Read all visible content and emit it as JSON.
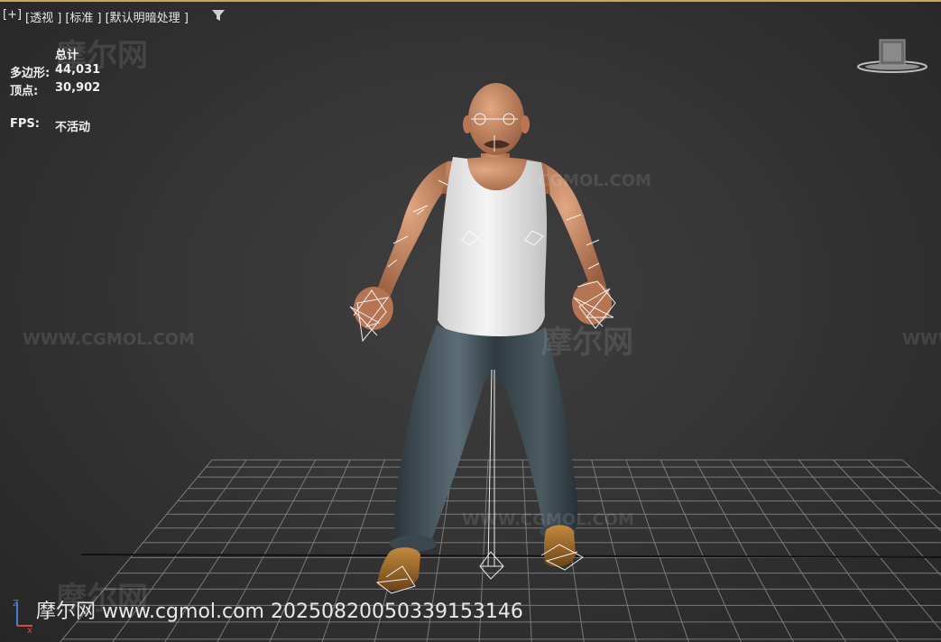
{
  "viewport": {
    "label_parts": [
      "[+]",
      "[透视 ]",
      "[标准 ]",
      "[默认明暗处理 ]"
    ],
    "filter_icon": "filter-funnel-icon"
  },
  "stats": {
    "header": "总计",
    "polygons_label": "多边形:",
    "polygons_value": "44,031",
    "vertices_label": "顶点:",
    "vertices_value": "30,902",
    "fps_label": "FPS:",
    "fps_value": "不活动"
  },
  "watermarks": {
    "logo": "摩尔网",
    "site_upper": "WWW.CGMOL.COM",
    "site_short": "CGMOL.COM",
    "site_www": "WWW"
  },
  "caption": "摩尔网 www.cgmol.com 20250820050339153146",
  "axis": {
    "z": "Z",
    "x": "x",
    "icon": "axis-tripod-icon"
  },
  "viewcube": {
    "icon": "viewcube-icon"
  },
  "colors": {
    "accent_border": "#c9a65a",
    "grid": "#8a8a8a",
    "skin": "#c98a63",
    "shirt": "#e8e8e8",
    "pants": "#3e4a52",
    "shoes": "#a8722e"
  }
}
